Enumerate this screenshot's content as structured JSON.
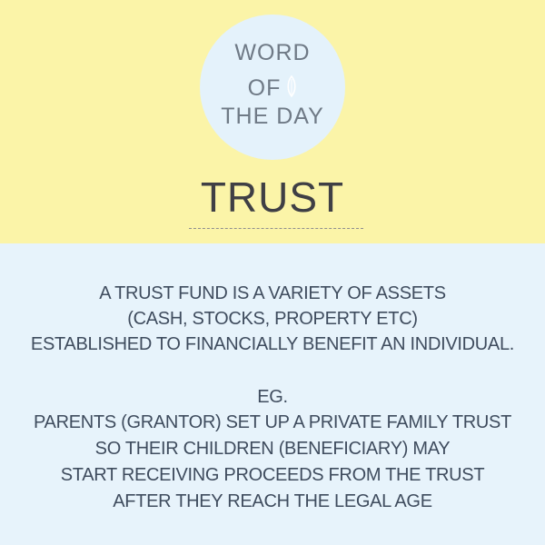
{
  "badge": {
    "line1": "WORD",
    "line2": "OF",
    "line3": "THE DAY",
    "icon": "leaf-icon"
  },
  "word": "TRUST",
  "definition": {
    "lines": [
      "A TRUST FUND IS A VARIETY OF ASSETS",
      "(CASH, STOCKS, PROPERTY ETC)",
      "ESTABLISHED TO FINANCIALLY BENEFIT AN INDIVIDUAL."
    ]
  },
  "example": {
    "label": "EG.",
    "lines": [
      "PARENTS (GRANTOR) SET UP A PRIVATE FAMILY TRUST",
      "SO THEIR CHILDREN (BENEFICIARY) MAY",
      "START RECEIVING PROCEEDS FROM THE TRUST",
      "AFTER THEY REACH THE LEGAL AGE"
    ]
  },
  "colors": {
    "top_background": "#fbf4a8",
    "bottom_background": "#e7f3fb",
    "circle": "#e4f2fb",
    "text": "#3f4c5e"
  }
}
